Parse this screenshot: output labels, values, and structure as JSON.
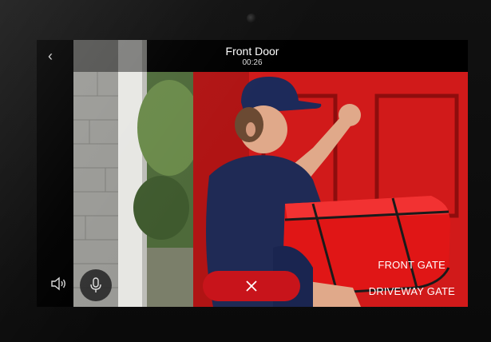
{
  "call": {
    "title": "Front Door",
    "duration": "00:26"
  },
  "gates": [
    {
      "label": "FRONT GATE"
    },
    {
      "label": "DRIVEWAY GATE"
    }
  ],
  "icons": {
    "back": "chevron-left-icon",
    "volume": "speaker-icon",
    "mic": "microphone-icon",
    "end": "close-icon"
  },
  "colors": {
    "end_button": "#c8141b",
    "door": "#d11a1a"
  }
}
